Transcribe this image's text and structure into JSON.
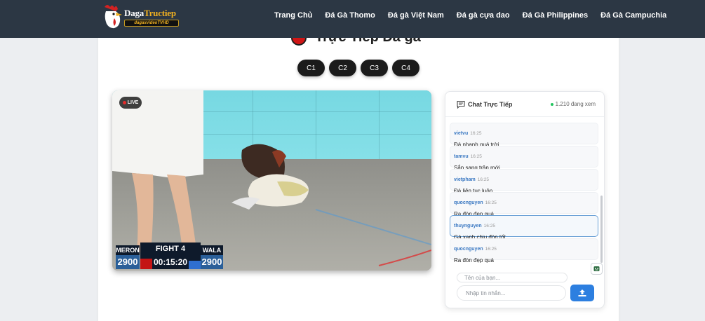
{
  "brand": {
    "name_main": "Daga",
    "name_highlight": "Tructiep",
    "tagline": "dagaxvideoTVHD"
  },
  "nav": [
    "Trang Chủ",
    "Đá Gà Thomo",
    "Đá gà Việt Nam",
    "Đá gà cựa dao",
    "Đá Gà Philippines",
    "Đá Gà Campuchia"
  ],
  "page_title": "Trực Tiếp Đá gà",
  "cameras": [
    "C1",
    "C2",
    "C3",
    "C4"
  ],
  "video": {
    "live": "LIVE",
    "meron_label": "MERON",
    "meron_score": "2900",
    "fight": "FIGHT 4",
    "timer": "00:15:20",
    "wala_label": "WALA",
    "wala_score": "2900"
  },
  "chat": {
    "title": "Chat Trực Tiếp",
    "viewers": "1.210 đang xem",
    "messages": [
      {
        "user": "vietvu",
        "time": "16:25",
        "text": "Đá nhanh quá trời"
      },
      {
        "user": "tamvu",
        "time": "16:25",
        "text": "Sắp sang trận mới"
      },
      {
        "user": "vietpham",
        "time": "16:25",
        "text": "Đá liên tục luôn"
      },
      {
        "user": "quocnguyen",
        "time": "16:25",
        "text": "Ra đòn đẹp quá"
      },
      {
        "user": "thuynguyen",
        "time": "16:25",
        "text": "Gà xanh chịu đòn tốt"
      },
      {
        "user": "quocnguyen",
        "time": "16:25",
        "text": "Ra đòn đẹp quá"
      }
    ],
    "name_placeholder": "Tên của bạn...",
    "message_placeholder": "Nhập tin nhắn..."
  },
  "colors": {
    "nav_bg": "#2c3744",
    "accent": "#2d7fe0",
    "live_red": "#d01616",
    "brand_gold": "#f0b020"
  }
}
